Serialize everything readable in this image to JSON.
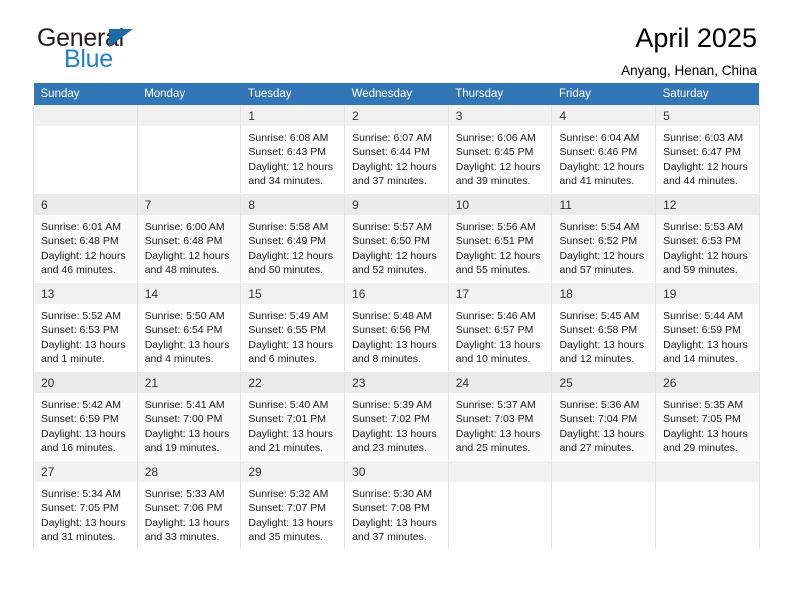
{
  "brand": {
    "name_part1": "General",
    "name_part2": "Blue",
    "triangle_color": "#1b6ca8",
    "blue_color": "#1f7fd1"
  },
  "header": {
    "title": "April 2025",
    "location": "Anyang, Henan, China"
  },
  "theme": {
    "header_row_bg": "#3276b8",
    "header_row_text": "#ffffff",
    "daynum_bg": "#f1f1f1",
    "cell_border": "#e2e2e2"
  },
  "weekday_headers": [
    "Sunday",
    "Monday",
    "Tuesday",
    "Wednesday",
    "Thursday",
    "Friday",
    "Saturday"
  ],
  "weeks": [
    [
      {
        "day": "",
        "sunrise": "",
        "sunset": "",
        "daylight1": "",
        "daylight2": ""
      },
      {
        "day": "",
        "sunrise": "",
        "sunset": "",
        "daylight1": "",
        "daylight2": ""
      },
      {
        "day": "1",
        "sunrise": "Sunrise: 6:08 AM",
        "sunset": "Sunset: 6:43 PM",
        "daylight1": "Daylight: 12 hours",
        "daylight2": "and 34 minutes."
      },
      {
        "day": "2",
        "sunrise": "Sunrise: 6:07 AM",
        "sunset": "Sunset: 6:44 PM",
        "daylight1": "Daylight: 12 hours",
        "daylight2": "and 37 minutes."
      },
      {
        "day": "3",
        "sunrise": "Sunrise: 6:06 AM",
        "sunset": "Sunset: 6:45 PM",
        "daylight1": "Daylight: 12 hours",
        "daylight2": "and 39 minutes."
      },
      {
        "day": "4",
        "sunrise": "Sunrise: 6:04 AM",
        "sunset": "Sunset: 6:46 PM",
        "daylight1": "Daylight: 12 hours",
        "daylight2": "and 41 minutes."
      },
      {
        "day": "5",
        "sunrise": "Sunrise: 6:03 AM",
        "sunset": "Sunset: 6:47 PM",
        "daylight1": "Daylight: 12 hours",
        "daylight2": "and 44 minutes."
      }
    ],
    [
      {
        "day": "6",
        "sunrise": "Sunrise: 6:01 AM",
        "sunset": "Sunset: 6:48 PM",
        "daylight1": "Daylight: 12 hours",
        "daylight2": "and 46 minutes."
      },
      {
        "day": "7",
        "sunrise": "Sunrise: 6:00 AM",
        "sunset": "Sunset: 6:48 PM",
        "daylight1": "Daylight: 12 hours",
        "daylight2": "and 48 minutes."
      },
      {
        "day": "8",
        "sunrise": "Sunrise: 5:58 AM",
        "sunset": "Sunset: 6:49 PM",
        "daylight1": "Daylight: 12 hours",
        "daylight2": "and 50 minutes."
      },
      {
        "day": "9",
        "sunrise": "Sunrise: 5:57 AM",
        "sunset": "Sunset: 6:50 PM",
        "daylight1": "Daylight: 12 hours",
        "daylight2": "and 52 minutes."
      },
      {
        "day": "10",
        "sunrise": "Sunrise: 5:56 AM",
        "sunset": "Sunset: 6:51 PM",
        "daylight1": "Daylight: 12 hours",
        "daylight2": "and 55 minutes."
      },
      {
        "day": "11",
        "sunrise": "Sunrise: 5:54 AM",
        "sunset": "Sunset: 6:52 PM",
        "daylight1": "Daylight: 12 hours",
        "daylight2": "and 57 minutes."
      },
      {
        "day": "12",
        "sunrise": "Sunrise: 5:53 AM",
        "sunset": "Sunset: 6:53 PM",
        "daylight1": "Daylight: 12 hours",
        "daylight2": "and 59 minutes."
      }
    ],
    [
      {
        "day": "13",
        "sunrise": "Sunrise: 5:52 AM",
        "sunset": "Sunset: 6:53 PM",
        "daylight1": "Daylight: 13 hours",
        "daylight2": "and 1 minute."
      },
      {
        "day": "14",
        "sunrise": "Sunrise: 5:50 AM",
        "sunset": "Sunset: 6:54 PM",
        "daylight1": "Daylight: 13 hours",
        "daylight2": "and 4 minutes."
      },
      {
        "day": "15",
        "sunrise": "Sunrise: 5:49 AM",
        "sunset": "Sunset: 6:55 PM",
        "daylight1": "Daylight: 13 hours",
        "daylight2": "and 6 minutes."
      },
      {
        "day": "16",
        "sunrise": "Sunrise: 5:48 AM",
        "sunset": "Sunset: 6:56 PM",
        "daylight1": "Daylight: 13 hours",
        "daylight2": "and 8 minutes."
      },
      {
        "day": "17",
        "sunrise": "Sunrise: 5:46 AM",
        "sunset": "Sunset: 6:57 PM",
        "daylight1": "Daylight: 13 hours",
        "daylight2": "and 10 minutes."
      },
      {
        "day": "18",
        "sunrise": "Sunrise: 5:45 AM",
        "sunset": "Sunset: 6:58 PM",
        "daylight1": "Daylight: 13 hours",
        "daylight2": "and 12 minutes."
      },
      {
        "day": "19",
        "sunrise": "Sunrise: 5:44 AM",
        "sunset": "Sunset: 6:59 PM",
        "daylight1": "Daylight: 13 hours",
        "daylight2": "and 14 minutes."
      }
    ],
    [
      {
        "day": "20",
        "sunrise": "Sunrise: 5:42 AM",
        "sunset": "Sunset: 6:59 PM",
        "daylight1": "Daylight: 13 hours",
        "daylight2": "and 16 minutes."
      },
      {
        "day": "21",
        "sunrise": "Sunrise: 5:41 AM",
        "sunset": "Sunset: 7:00 PM",
        "daylight1": "Daylight: 13 hours",
        "daylight2": "and 19 minutes."
      },
      {
        "day": "22",
        "sunrise": "Sunrise: 5:40 AM",
        "sunset": "Sunset: 7:01 PM",
        "daylight1": "Daylight: 13 hours",
        "daylight2": "and 21 minutes."
      },
      {
        "day": "23",
        "sunrise": "Sunrise: 5:39 AM",
        "sunset": "Sunset: 7:02 PM",
        "daylight1": "Daylight: 13 hours",
        "daylight2": "and 23 minutes."
      },
      {
        "day": "24",
        "sunrise": "Sunrise: 5:37 AM",
        "sunset": "Sunset: 7:03 PM",
        "daylight1": "Daylight: 13 hours",
        "daylight2": "and 25 minutes."
      },
      {
        "day": "25",
        "sunrise": "Sunrise: 5:36 AM",
        "sunset": "Sunset: 7:04 PM",
        "daylight1": "Daylight: 13 hours",
        "daylight2": "and 27 minutes."
      },
      {
        "day": "26",
        "sunrise": "Sunrise: 5:35 AM",
        "sunset": "Sunset: 7:05 PM",
        "daylight1": "Daylight: 13 hours",
        "daylight2": "and 29 minutes."
      }
    ],
    [
      {
        "day": "27",
        "sunrise": "Sunrise: 5:34 AM",
        "sunset": "Sunset: 7:05 PM",
        "daylight1": "Daylight: 13 hours",
        "daylight2": "and 31 minutes."
      },
      {
        "day": "28",
        "sunrise": "Sunrise: 5:33 AM",
        "sunset": "Sunset: 7:06 PM",
        "daylight1": "Daylight: 13 hours",
        "daylight2": "and 33 minutes."
      },
      {
        "day": "29",
        "sunrise": "Sunrise: 5:32 AM",
        "sunset": "Sunset: 7:07 PM",
        "daylight1": "Daylight: 13 hours",
        "daylight2": "and 35 minutes."
      },
      {
        "day": "30",
        "sunrise": "Sunrise: 5:30 AM",
        "sunset": "Sunset: 7:08 PM",
        "daylight1": "Daylight: 13 hours",
        "daylight2": "and 37 minutes."
      },
      {
        "day": "",
        "sunrise": "",
        "sunset": "",
        "daylight1": "",
        "daylight2": ""
      },
      {
        "day": "",
        "sunrise": "",
        "sunset": "",
        "daylight1": "",
        "daylight2": ""
      },
      {
        "day": "",
        "sunrise": "",
        "sunset": "",
        "daylight1": "",
        "daylight2": ""
      }
    ]
  ]
}
